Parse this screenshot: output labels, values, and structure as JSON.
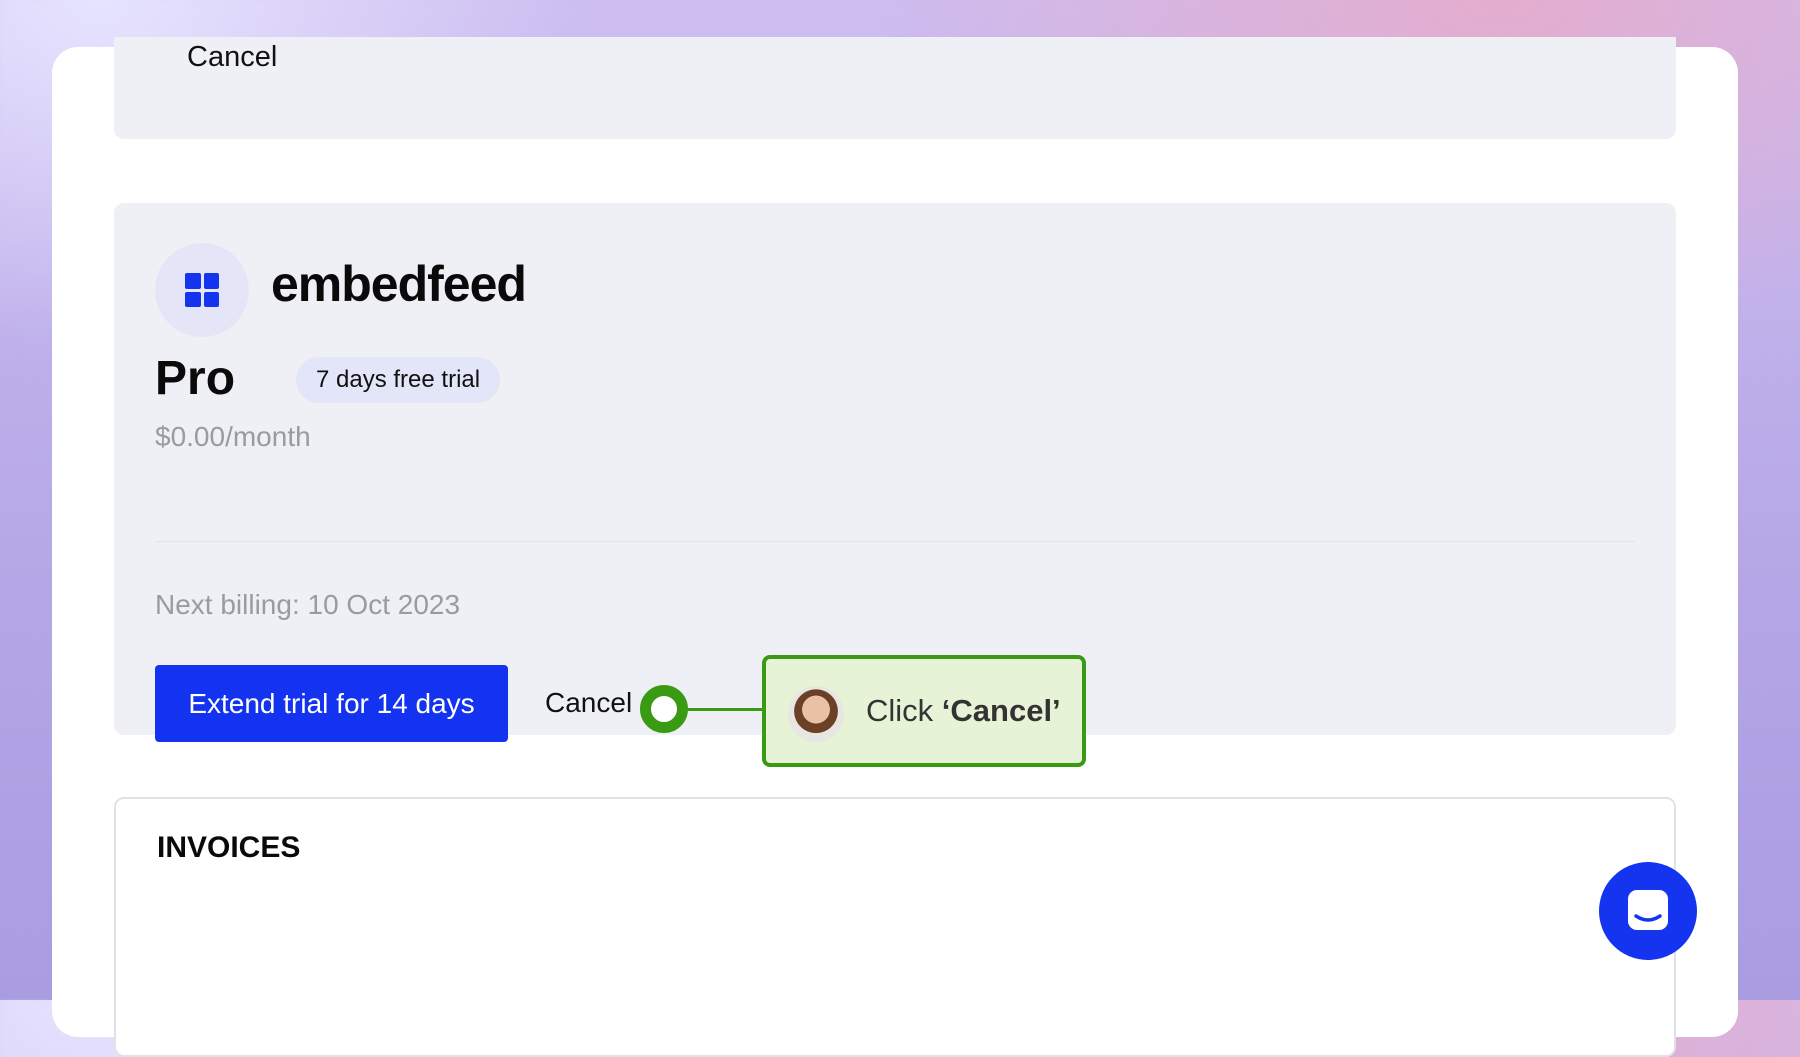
{
  "top_card": {
    "cancel_label": "Cancel"
  },
  "plan": {
    "brand": "embedfeed",
    "plan_name": "Pro",
    "trial_badge": "7 days free trial",
    "price": "$0.00/month",
    "next_billing": "Next billing: 10 Oct 2023",
    "extend_button": "Extend trial for 14 days",
    "cancel_link": "Cancel",
    "logo_icon": "grid-logo-icon"
  },
  "guide": {
    "tooltip_prefix": "Click ",
    "tooltip_target": "‘Cancel’",
    "accent_color": "#3a9a14",
    "avatar": "guide-avatar"
  },
  "invoices": {
    "title": "INVOICES"
  },
  "chat": {
    "icon": "chat-icon",
    "color": "#1534f0"
  }
}
